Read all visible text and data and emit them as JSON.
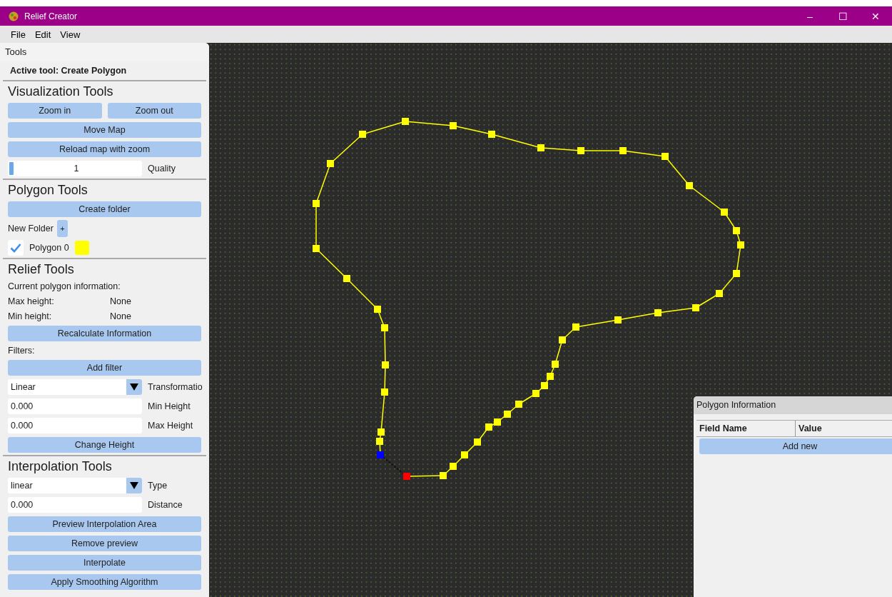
{
  "window": {
    "title": "Relief Creator",
    "controls": [
      "–",
      "☐",
      "✕"
    ]
  },
  "menu": [
    "File",
    "Edit",
    "View"
  ],
  "tools_panel": {
    "title": "Tools",
    "active_tool": "Active tool: Create Polygon",
    "sections": [
      {
        "heading": "Visualization Tools",
        "rows": [
          {
            "kind": "button_pair",
            "buttons": [
              "Zoom in",
              "Zoom out"
            ]
          },
          {
            "kind": "button",
            "label": "Move Map"
          },
          {
            "kind": "button",
            "label": "Reload map with zoom"
          },
          {
            "kind": "slider",
            "reading": "1",
            "level": 0.03,
            "name": "Quality"
          }
        ]
      },
      {
        "heading": "Polygon Tools",
        "rows": [
          {
            "kind": "button",
            "label": "Create folder"
          },
          {
            "kind": "folder",
            "label": "New Folder",
            "button": "+"
          },
          {
            "kind": "layer",
            "label": "Polygon 0",
            "checked": true,
            "color": "#ffff00"
          }
        ]
      },
      {
        "heading": "Relief Tools",
        "rows": [
          {
            "kind": "text",
            "text": "Current polygon information:"
          },
          {
            "kind": "pair",
            "label": "Max height:",
            "value": "None"
          },
          {
            "kind": "pair",
            "label": "Min height:",
            "value": "None"
          },
          {
            "kind": "button",
            "label": "Recalculate Information"
          },
          {
            "kind": "text",
            "text": "Filters:"
          },
          {
            "kind": "button",
            "label": "Add filter"
          },
          {
            "kind": "select",
            "value": "Linear",
            "label": "Transformatio"
          },
          {
            "kind": "input",
            "value": "0.000",
            "label": "Min Height"
          },
          {
            "kind": "input",
            "value": "0.000",
            "label": "Max Height"
          },
          {
            "kind": "button",
            "label": "Change Height"
          }
        ]
      },
      {
        "heading": "Interpolation Tools",
        "rows": [
          {
            "kind": "select",
            "value": "linear",
            "label": "Type"
          },
          {
            "kind": "input",
            "value": "0.000",
            "label": "Distance"
          },
          {
            "kind": "button",
            "label": "Preview Interpolation Area"
          },
          {
            "kind": "button",
            "label": "Remove preview"
          },
          {
            "kind": "button",
            "label": "Interpolate"
          },
          {
            "kind": "button",
            "label": "Apply Smoothing Algorithm"
          }
        ]
      }
    ]
  },
  "polygon_info": {
    "title": "Polygon Information",
    "columns": [
      "Field Name",
      "Value"
    ],
    "button": "Add new"
  }
}
